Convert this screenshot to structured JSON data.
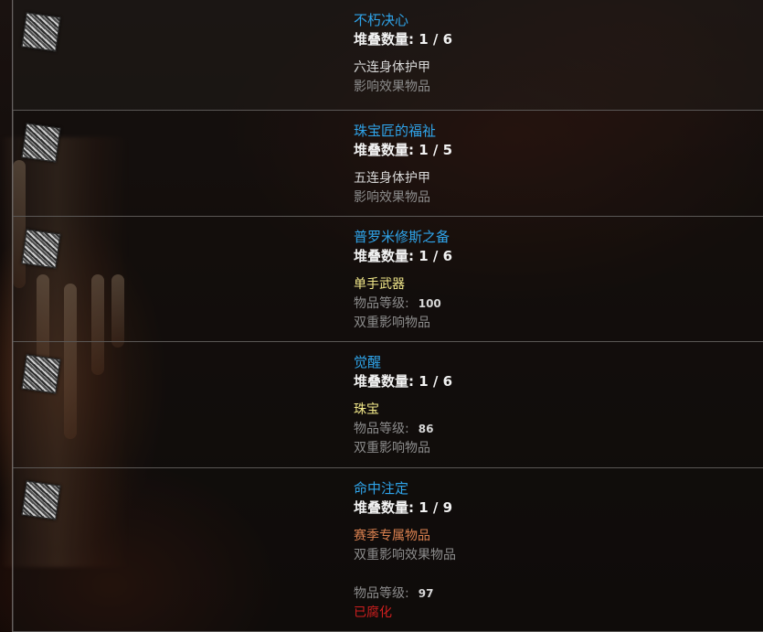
{
  "stack_label": "堆叠数量:",
  "level_label": "物品等级:",
  "items": [
    {
      "name": "不朽决心",
      "stack": "1 / 6",
      "type": "六连身体护甲",
      "note": "影响效果物品"
    },
    {
      "name": "珠宝匠的福祉",
      "stack": "1 / 5",
      "type": "五连身体护甲",
      "note": "影响效果物品"
    },
    {
      "name": "普罗米修斯之备",
      "stack": "1 / 6",
      "type": "单手武器",
      "level": "100",
      "note": "双重影响物品"
    },
    {
      "name": "觉醒",
      "stack": "1 / 6",
      "type": "珠宝",
      "level": "86",
      "note": "双重影响物品"
    },
    {
      "name": "命中注定",
      "stack": "1 / 9",
      "type": "赛季专属物品",
      "note": "双重影响效果物品",
      "level": "97",
      "status": "已腐化"
    }
  ],
  "colors": {
    "name": "#2fa4ea",
    "unique_type": "#f3e98a",
    "league": "#d9804f",
    "corrupted": "#d01f1f"
  },
  "icons": [
    "divination-card-icon"
  ]
}
